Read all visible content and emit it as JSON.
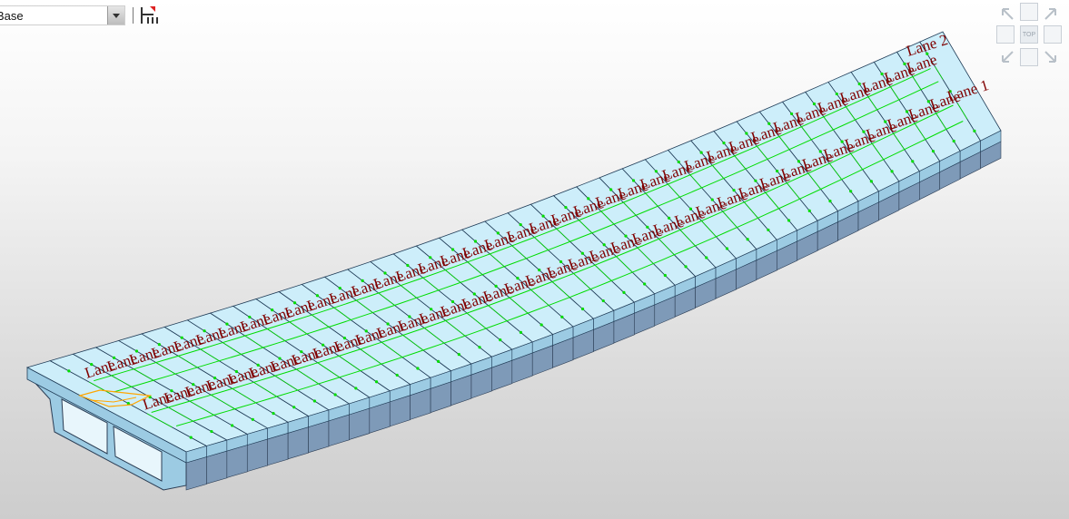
{
  "toolbar": {
    "view_selector_value": "Base",
    "dropdown_icon": "chevron-down-icon",
    "tool_icon": "load-lane-tool-icon"
  },
  "viewcube": {
    "top_label": "TOP",
    "icons": [
      "arrow-nw-icon",
      "arrow-ne-icon",
      "arrow-sw-icon",
      "arrow-se-icon"
    ]
  },
  "scene": {
    "lane_1_label": "Lane 1",
    "lane_2_label": "Lane 2",
    "lane_1_repeat_label": "Lane",
    "lane_2_repeat_label": "Lane",
    "colors": {
      "deck_top": "#cdeefa",
      "deck_side": "#9ccbe3",
      "girder": "#7e9ab8",
      "lane_green": "#00dd00",
      "label": "#800000",
      "marker": "#ffa500"
    }
  }
}
